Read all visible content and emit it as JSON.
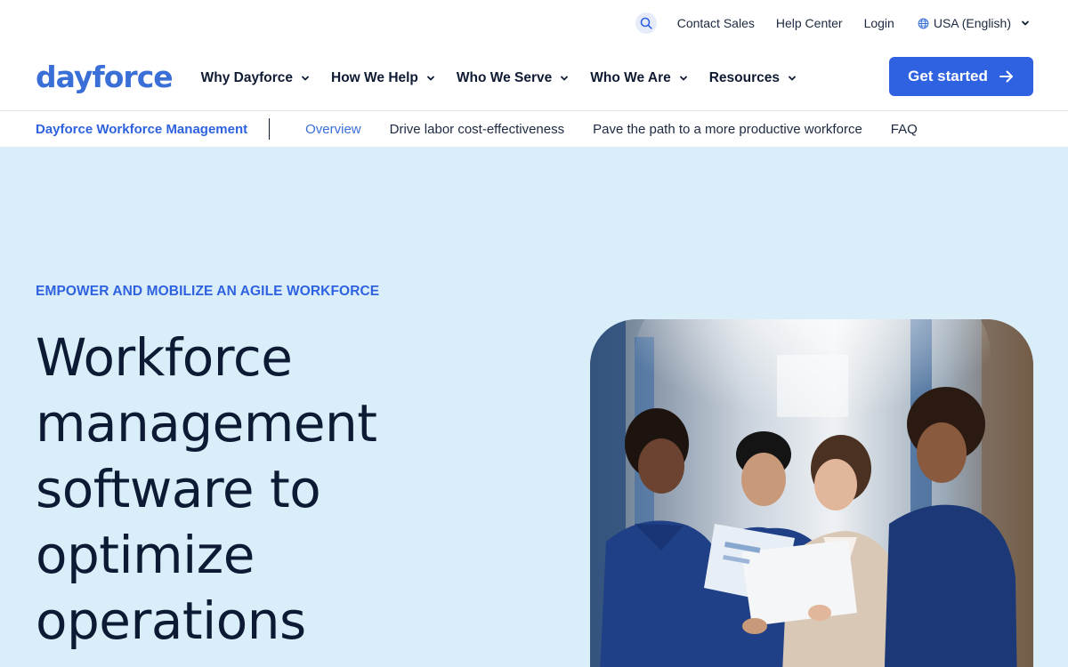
{
  "utility": {
    "search_icon": "search-icon",
    "links": [
      "Contact Sales",
      "Help Center",
      "Login"
    ],
    "locale": "USA (English)"
  },
  "brand": {
    "logo_text": "dayforce",
    "accent": "#2f62e0",
    "logo_color": "#3a6fd8",
    "hero_bg": "#daeefa",
    "ink": "#0f1b33"
  },
  "nav": {
    "items": [
      "Why Dayforce",
      "How We Help",
      "Who We Serve",
      "Who We Are",
      "Resources"
    ],
    "cta_label": "Get started"
  },
  "subnav": {
    "title": "Dayforce Workforce Management",
    "links": [
      "Overview",
      "Drive labor cost-effectiveness",
      "Pave the path to a more productive workforce",
      "FAQ"
    ]
  },
  "hero": {
    "eyebrow": "EMPOWER AND MOBILIZE AN AGILE WORKFORCE",
    "headline_lines": [
      "Workforce",
      "management",
      "software to",
      "optimize",
      "operations"
    ]
  }
}
